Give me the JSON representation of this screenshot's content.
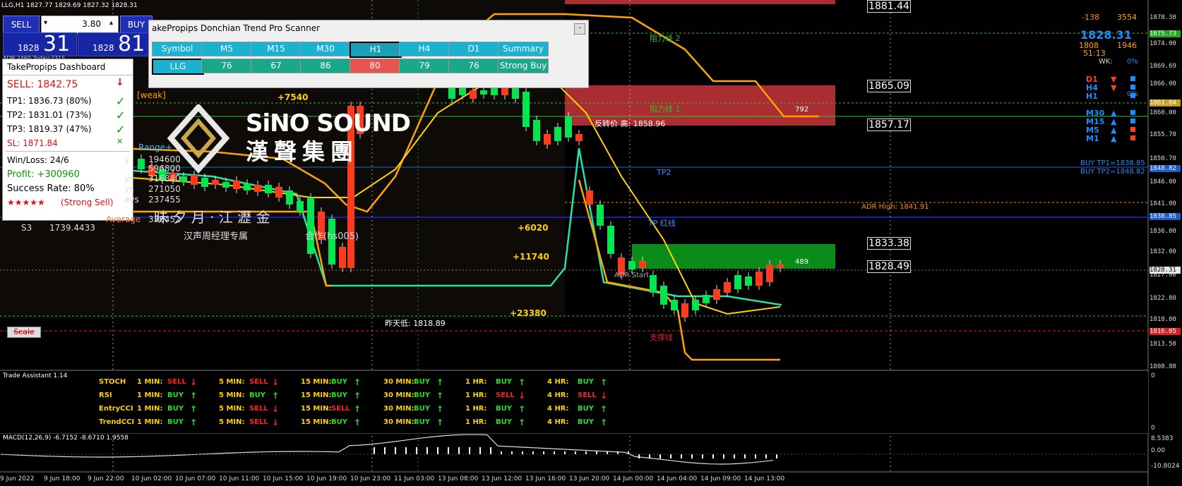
{
  "window": {
    "symbol_title": "LLG,H1  1827.77 1829.69 1827.32 1828.31"
  },
  "trade_widget": {
    "sell_label": "SELL",
    "buy_label": "BUY",
    "lot": "3.80",
    "sell_small": "1828",
    "sell_big": "31",
    "buy_small": "1828",
    "buy_big": "81",
    "adr_text": "ADR:2460  Today:2315"
  },
  "dashboard": {
    "title": "TakePropips Dashboard",
    "signal": "SELL: 1842.75",
    "tp1": "TP1: 1836.73 (80%)",
    "tp2": "TP2: 1831.01 (73%)",
    "tp3": "TP3: 1819.37 (47%)",
    "sl": "SL:  1871.84",
    "winloss": "Win/Loss: 24/6",
    "profit": "Profit: +300960",
    "success": "Success Rate: 80%",
    "stars": "★★★★★",
    "strength": "(Strong Sell)"
  },
  "scanner": {
    "title": "akePropips Donchian Trend Pro Scanner",
    "min_button": "-",
    "headers": [
      "Symbol",
      "M5",
      "M15",
      "M30",
      "H1",
      "H4",
      "D1",
      "Summary"
    ],
    "row": [
      "LLG",
      "76",
      "67",
      "86",
      "80",
      "79",
      "76",
      "Strong Buy"
    ]
  },
  "chart": {
    "sino_sound": "SiNO SOUND",
    "sino_chinese": "漢聲集團",
    "poem": "昧    夕    月    ·   江    瀝    金",
    "manager": "汉声周经理专属",
    "wechat": "合作(hs005)",
    "weak": "[weak]",
    "range_plus": "Range+",
    "stats": [
      {
        "label": "y",
        "value": "194600"
      },
      {
        "label": "",
        "value": "596800"
      },
      {
        "label": "ys",
        "value": "316840"
      },
      {
        "label": "ys",
        "value": "271050"
      },
      {
        "label": "ays",
        "value": "237455"
      },
      {
        "label": "Average",
        "value": "336452"
      }
    ],
    "s3_label": "S3",
    "s3_value": "1739.4433",
    "profit_marks": [
      "+7540",
      "+6020",
      "+11740",
      "+23380"
    ],
    "zone_labels": {
      "resistance2": "阻力线 2",
      "resistance1": "阻力线 1",
      "reversal": "反转价 高: 1858.96",
      "tp2": "TP2",
      "tp_line": "TP 红线",
      "adr_start": "ADR Start",
      "support": "支撑线",
      "yesterday_low": "昨天低: 1818.89",
      "adr_high": "ADR High: 1841.91",
      "scale": "Scale",
      "box_792": "792",
      "box_489": "489"
    },
    "right_boxes": [
      "1881.44",
      "1865.09",
      "1857.17",
      "1833.38",
      "1828.49"
    ],
    "right_info": {
      "neg": "-138",
      "pos": "3554",
      "price": "1828.31",
      "a": "1808",
      "b": "1946",
      "time": "51:13",
      "wk": "WK:",
      "wk_pct": "0%",
      "d1_pct": "0%",
      "buy_tp1": "BUY TP1=1838.85",
      "buy_tp2": "BUY TP2=1848.82"
    },
    "timeframes": [
      "D1",
      "H4",
      "H1",
      "M30",
      "M15",
      "M5",
      "M1"
    ],
    "price_axis": [
      "1878.30",
      "1875.73",
      "1874.00",
      "1869.69",
      "1866.00",
      "1861.64",
      "1860.00",
      "1855.70",
      "1850.70",
      "1848.82",
      "1846.00",
      "1841.00",
      "1838.85",
      "1836.00",
      "1832.00",
      "1828.31",
      "1827.00",
      "1822.80",
      "1818.00",
      "1816.05",
      "1813.50",
      "1808.80"
    ],
    "dates": [
      "9 Jun 2022",
      "9 Jun 18:00",
      "9 Jun 22:00",
      "10 Jun 02:00",
      "10 Jun 07:00",
      "10 Jun 11:00",
      "10 Jun 15:00",
      "10 Jun 19:00",
      "10 Jun 23:00",
      "11 Jun 03:00",
      "13 Jun 08:00",
      "13 Jun 12:00",
      "13 Jun 16:00",
      "13 Jun 20:00",
      "14 Jun 00:00",
      "14 Jun 04:00",
      "14 Jun 09:00",
      "14 Jun 13:00"
    ]
  },
  "assistant": {
    "title": "Trade Assistant 1.14",
    "rows": [
      {
        "name": "STOCH",
        "cells": [
          [
            "1 MIN:",
            "SELL",
            "down"
          ],
          [
            "5 MIN:",
            "SELL",
            "down"
          ],
          [
            "15 MIN:",
            "BUY",
            "up"
          ],
          [
            "30 MIN:",
            "BUY",
            "up"
          ],
          [
            "1 HR:",
            "BUY",
            "up"
          ],
          [
            "4 HR:",
            "BUY",
            "up"
          ]
        ]
      },
      {
        "name": "RSI",
        "cells": [
          [
            "1 MIN:",
            "BUY",
            "up"
          ],
          [
            "5 MIN:",
            "BUY",
            "up"
          ],
          [
            "15 MIN:",
            "BUY",
            "up"
          ],
          [
            "30 MIN:",
            "BUY",
            "up"
          ],
          [
            "1 HR:",
            "SELL",
            "down"
          ],
          [
            "4 HR:",
            "SELL",
            "down"
          ]
        ]
      },
      {
        "name": "EntryCCI",
        "cells": [
          [
            "1 MIN:",
            "BUY",
            "up"
          ],
          [
            "5 MIN:",
            "SELL",
            "down"
          ],
          [
            "15 MIN:",
            "SELL",
            "up"
          ],
          [
            "30 MIN:",
            "BUY",
            "up"
          ],
          [
            "1 HR:",
            "BUY",
            "up"
          ],
          [
            "4 HR:",
            "BUY",
            "up"
          ]
        ]
      },
      {
        "name": "TrendCCI",
        "cells": [
          [
            "1 MIN:",
            "BUY",
            "up"
          ],
          [
            "5 MIN:",
            "SELL",
            "down"
          ],
          [
            "15 MIN:",
            "BUY",
            "up"
          ],
          [
            "30 MIN:",
            "BUY",
            "up"
          ],
          [
            "1 HR:",
            "BUY",
            "up"
          ],
          [
            "4 HR:",
            "BUY",
            "up"
          ]
        ]
      }
    ],
    "axis_top": "0",
    "axis_bottom": "0"
  },
  "macd": {
    "label": "MACD(12,26,9) -6.7152 -8.6710 1.9558",
    "axis": [
      "8.5383",
      "0.00",
      "-10.8024"
    ]
  },
  "colors": {
    "green_candle": "#00e64d",
    "red_candle": "#ff3b1f",
    "accent_orange": "#ffa500",
    "teal_line": "#21e6a6",
    "yellow_line": "#ffd200",
    "resistance_red": "#c8353a",
    "support_green": "#0a8c1a"
  }
}
